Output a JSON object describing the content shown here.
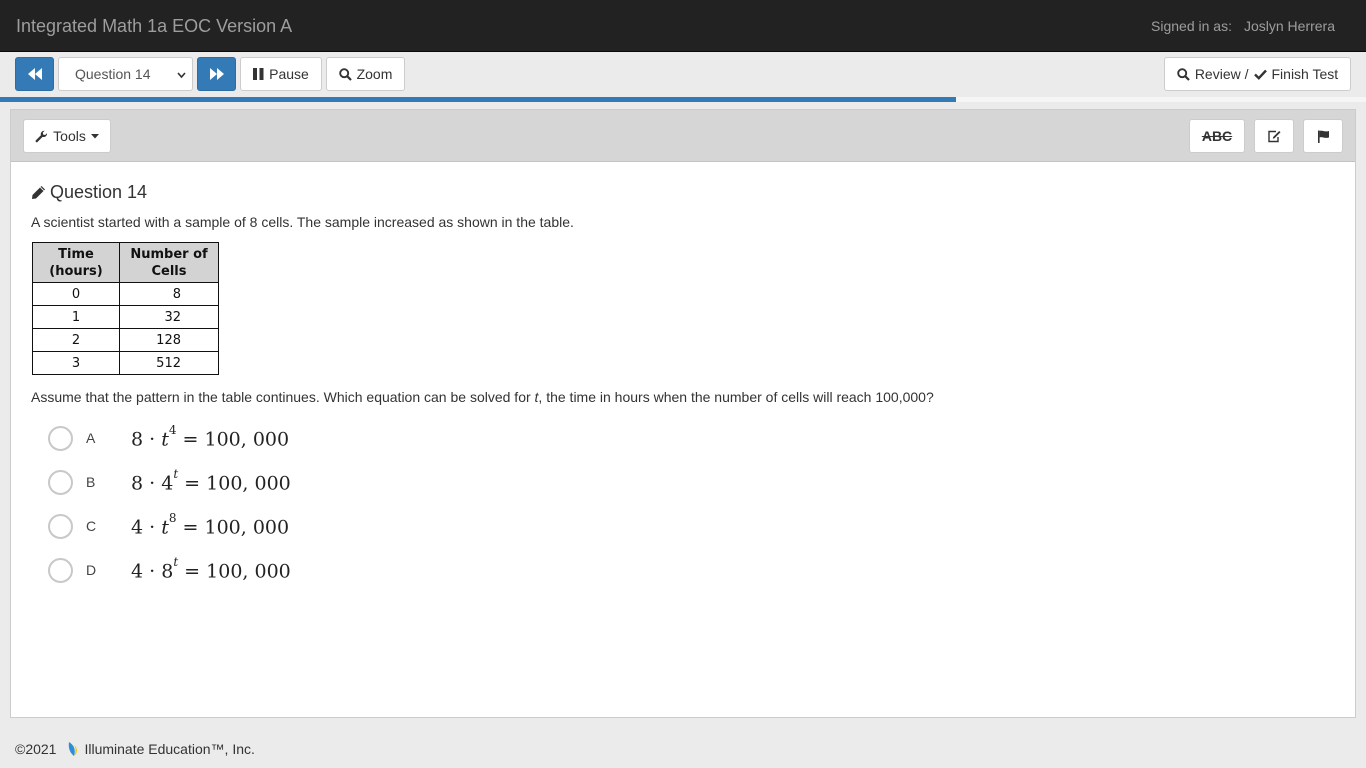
{
  "header": {
    "title": "Integrated Math 1a EOC Version A",
    "signed_in_label": "Signed in as:",
    "user_name": "Joslyn Herrera"
  },
  "toolbar": {
    "prev_icon": "fast-backward-icon",
    "next_icon": "fast-forward-icon",
    "question_select": {
      "selected": "Question 14"
    },
    "pause_label": "Pause",
    "zoom_label": "Zoom",
    "review_label": "Review /",
    "finish_label": "Finish Test"
  },
  "progress": {
    "percent": 70
  },
  "panel": {
    "tools_label": "Tools",
    "strikethrough_label": "ABC",
    "notes_icon": "edit-icon",
    "flag_icon": "flag-icon"
  },
  "question": {
    "heading": "Question 14",
    "prompt": "A scientist started with a sample of 8 cells. The sample increased as shown in the table.",
    "table": {
      "headers": [
        [
          "Time",
          "(hours)"
        ],
        [
          "Number of",
          "Cells"
        ]
      ],
      "rows": [
        [
          "0",
          "8"
        ],
        [
          "1",
          "32"
        ],
        [
          "2",
          "128"
        ],
        [
          "3",
          "512"
        ]
      ]
    },
    "question_before": "Assume that the pattern in the table continues. Which equation can be solved for ",
    "question_var": "t",
    "question_after": ", the time in hours when the number of cells will reach 100,000?",
    "choices": [
      {
        "letter": "A",
        "base": "8 · ",
        "var": "t",
        "exp": "4",
        "rhs": " = 100, 000"
      },
      {
        "letter": "B",
        "base": "8 · ",
        "var": "4",
        "exp": "t",
        "rhs": " = 100, 000"
      },
      {
        "letter": "C",
        "base": "4 · ",
        "var": "t",
        "exp": "8",
        "rhs": " = 100, 000"
      },
      {
        "letter": "D",
        "base": "4 · ",
        "var": "8",
        "exp": "t",
        "rhs": " = 100, 000"
      }
    ]
  },
  "footer": {
    "copyright": "©2021",
    "company": "Illuminate Education™, Inc."
  },
  "colors": {
    "primary": "#337ab7",
    "header_bg": "#222222",
    "logo_blue": "#2a8fd6",
    "logo_yellow": "#f0c419"
  }
}
